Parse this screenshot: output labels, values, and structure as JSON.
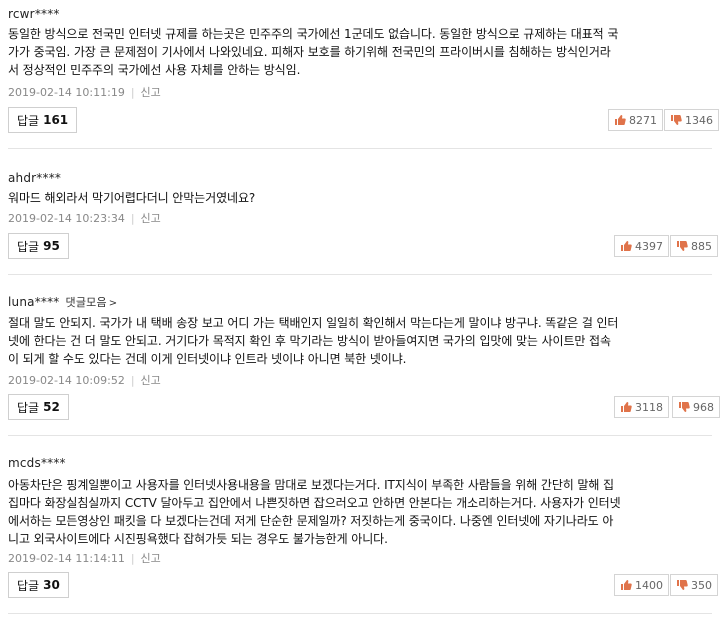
{
  "colors": {
    "thumb": "#e0734a",
    "separator": "#e4e4e4",
    "meta": "#888888"
  },
  "icons": {
    "up": "thumbs-up-icon",
    "down": "thumbs-down-icon"
  },
  "comments": [
    {
      "author": "rcwr****",
      "author_link": "",
      "lines": [
        "동일한 방식으로 전국민 인터넷 규제를 하는곳은 민주주의 국가에선 1군데도 없습니다. 동일한 방식으로 규제하는 대표적 국",
        "가가 중국임. 가장 큰 문제점이 기사에서 나와있네요. 피해자 보호를 하기위해 전국민의 프라이버시를 침해하는 방식인거라",
        "서 정상적인 민주주의 국가에선 사용 자체를 안하는 방식임."
      ],
      "timestamp": "2019-02-14 10:11:19",
      "report": "신고",
      "reply_label": "답글",
      "reply_count": "161",
      "likes": "8271",
      "dislikes": "1346"
    },
    {
      "author": "ahdr****",
      "author_link": "",
      "lines": [
        "워마드 해외라서 막기어렵다더니 안막는거였네요?"
      ],
      "timestamp": "2019-02-14 10:23:34",
      "report": "신고",
      "reply_label": "답글",
      "reply_count": "95",
      "likes": "4397",
      "dislikes": "885"
    },
    {
      "author": "luna****",
      "author_link": "댓글모음",
      "lines": [
        "절대 말도 안되지. 국가가 내 택배 송장 보고 어디 가는 택배인지 일일히 확인해서 막는다는게 말이냐 방구냐. 똑같은 걸 인터",
        "넷에 한다는 건 더 말도 안되고. 거기다가 목적지 확인 후 막기라는 방식이 받아들여지면 국가의 입맛에 맞는 사이트만 접속",
        "이 되게 할 수도 있다는 건데 이게 인터넷이냐 인트라 넷이냐 아니면 북한 넷이냐."
      ],
      "timestamp": "2019-02-14 10:09:52",
      "report": "신고",
      "reply_label": "답글",
      "reply_count": "52",
      "likes": "3118",
      "dislikes": "968"
    },
    {
      "author": "mcds****",
      "author_link": "",
      "lines": [
        "아동차단은 핑계일뿐이고 사용자를 인터넷사용내용을 맘대로 보겠다는거다. IT지식이 부족한 사람들을 위해 간단히 말해 집",
        "집마다 화장실침실까지 CCTV 달아두고 집안에서 나쁜짓하면 잡으러오고 안하면 안본다는 개소리하는거다. 사용자가 인터넷",
        "에서하는 모든영상인 패킷을 다 보겠다는건데 저게 단순한 문제일까? 저짓하는게 중국이다. 나중엔 인터넷에 자기나라도 아",
        "니고 외국사이트에다 시진핑욕했다 잡혀가듯 되는 경우도 불가능한게 아니다."
      ],
      "timestamp": "2019-02-14 11:14:11",
      "report": "신고",
      "reply_label": "답글",
      "reply_count": "30",
      "likes": "1400",
      "dislikes": "350"
    }
  ]
}
